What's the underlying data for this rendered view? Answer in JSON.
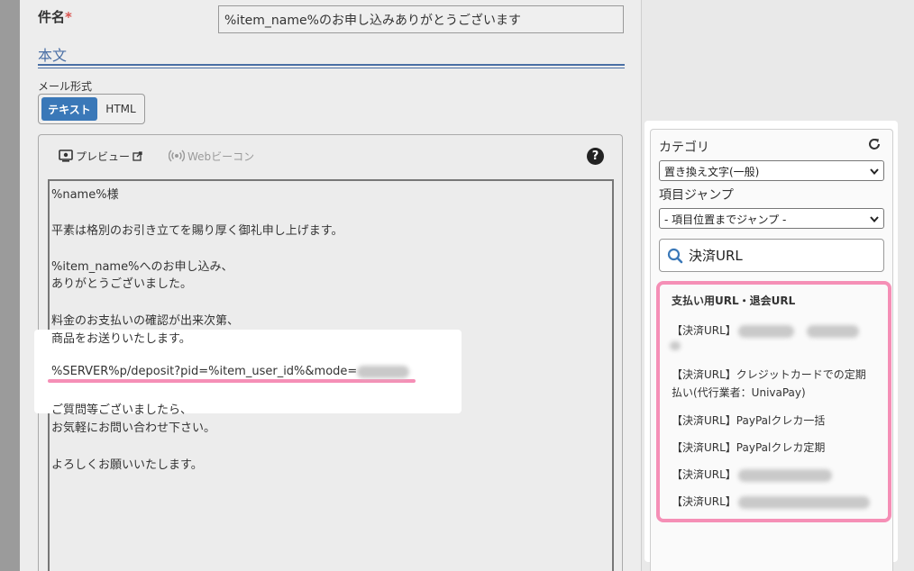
{
  "form": {
    "subject_label": "件名",
    "required_mark": "*",
    "subject_value": "%item_name%のお申し込みありがとうございます",
    "section_title": "本文",
    "mail_format_label": "メール形式",
    "format_text": "テキスト",
    "format_html": "HTML"
  },
  "editor": {
    "preview_label": "プレビュー",
    "webbeacon_label": "Webビーコン",
    "help_label": "?",
    "lines": [
      "%name%様",
      "平素は格別のお引き立てを賜り厚く御礼申し上げます。",
      "%item_name%へのお申し込み、",
      "ありがとうございました。",
      "料金のお支払いの確認が出来次第、",
      "商品をお送りいたします。",
      "%SERVER%p/deposit?pid=%item_user_id%&mode=",
      "ご質問等ございましたら、",
      "お気軽にお問い合わせ下さい。",
      "よろしくお願いいたします。"
    ]
  },
  "sidebar": {
    "category_label": "カテゴリ",
    "category_value": "置き換え文字(一般)",
    "jump_label": "項目ジャンプ",
    "jump_value": "- 項目位置までジャンプ -",
    "search_value": "決済URL",
    "results_heading": "支払い用URL・退会URL",
    "results": [
      "【決済URL】",
      "【決済URL】クレジットカードでの定期払い(代行業者：UnivaPay)",
      "【決済URL】PayPalクレカ一括",
      "【決済URL】PayPalクレカ定期",
      "【決済URL】",
      "【決済URL】"
    ]
  },
  "colors": {
    "accent_blue": "#3a78b8",
    "section_blue": "#4a6fa5",
    "highlight_pink": "#f58fb6",
    "required_red": "#d9534f"
  }
}
